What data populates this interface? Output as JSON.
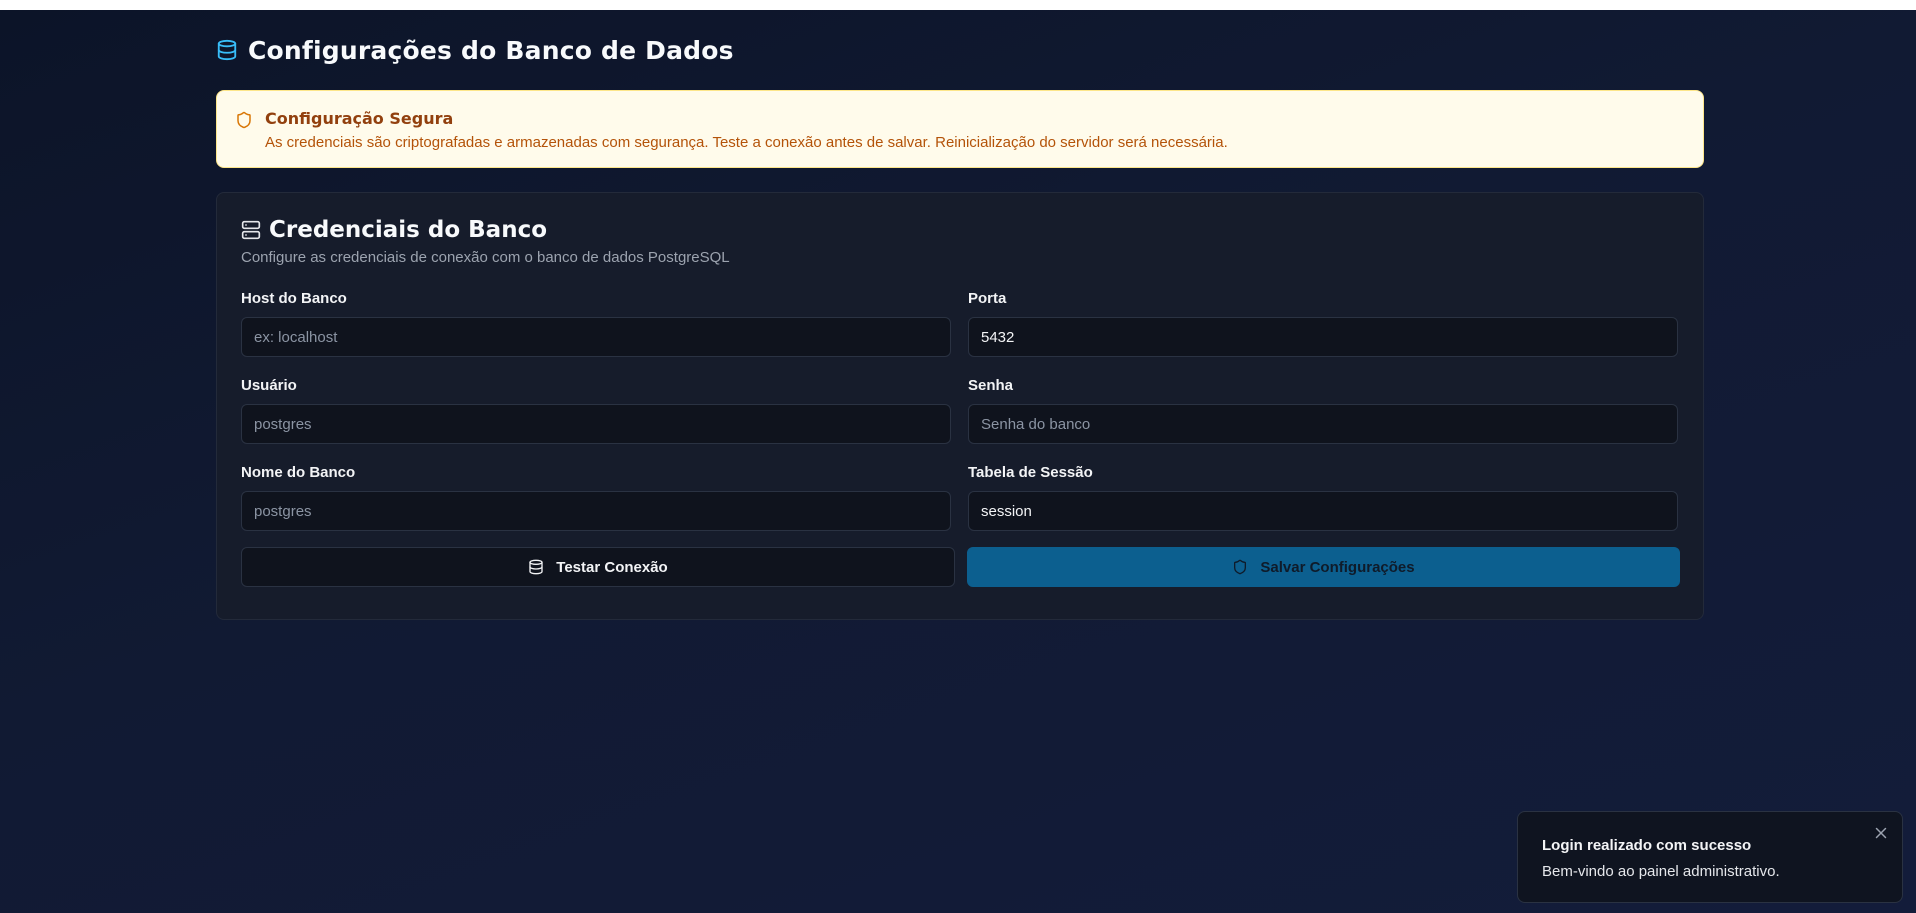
{
  "header": {
    "title": "Configurações do Banco de Dados",
    "icon": "database-icon"
  },
  "alert": {
    "icon": "shield-icon",
    "title": "Configuração Segura",
    "text": "As credenciais são criptografadas e armazenadas com segurança. Teste a conexão antes de salvar. Reinicialização do servidor será necessária."
  },
  "card": {
    "icon": "server-icon",
    "title": "Credenciais do Banco",
    "description": "Configure as credenciais de conexão com o banco de dados PostgreSQL",
    "fields": {
      "host": {
        "label": "Host do Banco",
        "value": "",
        "placeholder": "ex: localhost"
      },
      "port": {
        "label": "Porta",
        "value": "5432",
        "placeholder": ""
      },
      "user": {
        "label": "Usuário",
        "value": "",
        "placeholder": "postgres"
      },
      "password": {
        "label": "Senha",
        "value": "",
        "placeholder": "Senha do banco"
      },
      "dbname": {
        "label": "Nome do Banco",
        "value": "",
        "placeholder": "postgres"
      },
      "session_table": {
        "label": "Tabela de Sessão",
        "value": "session",
        "placeholder": ""
      }
    },
    "buttons": {
      "test": "Testar Conexão",
      "save": "Salvar Configurações"
    }
  },
  "toast": {
    "title": "Login realizado com sucesso",
    "description": "Bem-vindo ao painel administrativo.",
    "close_icon": "close-icon"
  },
  "colors": {
    "accent": "#38bdf8",
    "primary_button": "#0c5f8f",
    "alert_background": "#fffbeb",
    "alert_title": "#92400e",
    "alert_text": "#b45309"
  }
}
